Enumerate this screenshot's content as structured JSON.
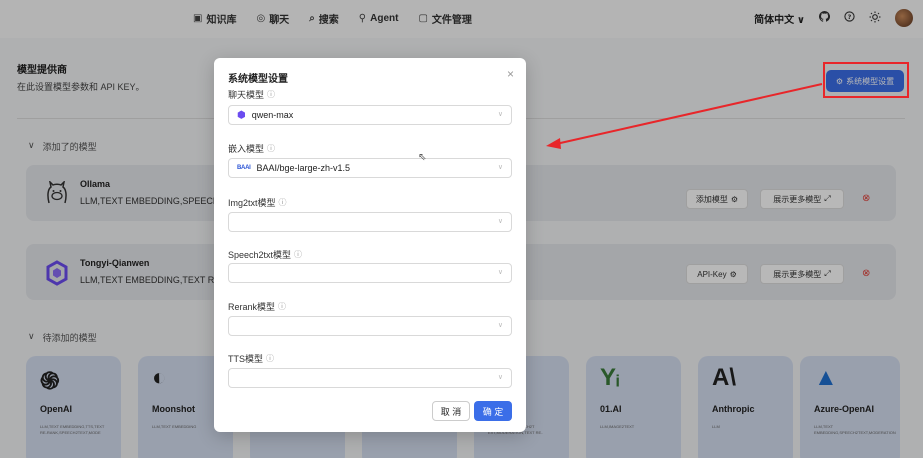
{
  "nav": {
    "items": [
      {
        "icon": "▣",
        "label": "知识库"
      },
      {
        "icon": "◎",
        "label": "聊天"
      },
      {
        "icon": "⌕",
        "label": "搜索"
      },
      {
        "icon": "⚲",
        "label": "Agent"
      },
      {
        "icon": "▢",
        "label": "文件管理"
      }
    ],
    "language": "简体中文",
    "language_chevron": "∨"
  },
  "page": {
    "title": "模型提供商",
    "desc": "在此设置模型参数和 API KEY。",
    "sys_button": "系统模型设置",
    "added_section": "添加了的模型",
    "pending_section": "待添加的模型",
    "section_chevron": "∨"
  },
  "added_models": [
    {
      "name": "Ollama",
      "tags": "LLM,TEXT EMBEDDING,SPEECH2",
      "btn1": "添加模型",
      "btn2": "展示更多模型"
    },
    {
      "name": "Tongyi-Qianwen",
      "tags": "LLM,TEXT EMBEDDING,TEXT RE-",
      "btn1": "API-Key",
      "btn2": "展示更多模型"
    }
  ],
  "providers": [
    {
      "name": "OpenAI",
      "tags": "LLM,TEXT EMBEDDING,TTS,TEXT RE-RANK,SPEECH2TEXT,MODE",
      "logo": "֍"
    },
    {
      "name": "Moonshot",
      "tags": "LLM,TEXT EMBEDDING",
      "logo": "◐"
    },
    {
      "name": "",
      "tags": "",
      "logo": ""
    },
    {
      "name": "",
      "tags": "EMBEDDING,SPEECH2TEXT,MODERATION",
      "logo": ""
    },
    {
      "name": "",
      "tags": "EMBEDDING,SPEECH2T EXT,MODERATION,TEXT RE-",
      "logo": ""
    },
    {
      "name": "01.AI",
      "tags": "LLM,IMAGE2TEXT",
      "logo": "Yᵢ"
    },
    {
      "name": "Anthropic",
      "tags": "LLM",
      "logo": "A\\"
    },
    {
      "name": "Azure-OpenAI",
      "tags": "LLM,TEXT EMBEDDING,SPEECH2TEXT,MODERATION",
      "logo": "▲"
    }
  ],
  "modal": {
    "title": "系统模型设置",
    "close": "×",
    "fields": [
      {
        "label": "聊天模型",
        "value": "qwen-max"
      },
      {
        "label": "嵌入模型",
        "value": "BAAI/bge-large-zh-v1.5"
      },
      {
        "label": "Img2txt模型",
        "value": ""
      },
      {
        "label": "Speech2txt模型",
        "value": ""
      },
      {
        "label": "Rerank模型",
        "value": ""
      },
      {
        "label": "TTS模型",
        "value": ""
      }
    ],
    "help": "?",
    "baai": "BAAI",
    "cancel": "取 消",
    "ok": "确 定"
  },
  "colors": {
    "accent": "#3b6ee8",
    "highlight": "#e8262a"
  }
}
